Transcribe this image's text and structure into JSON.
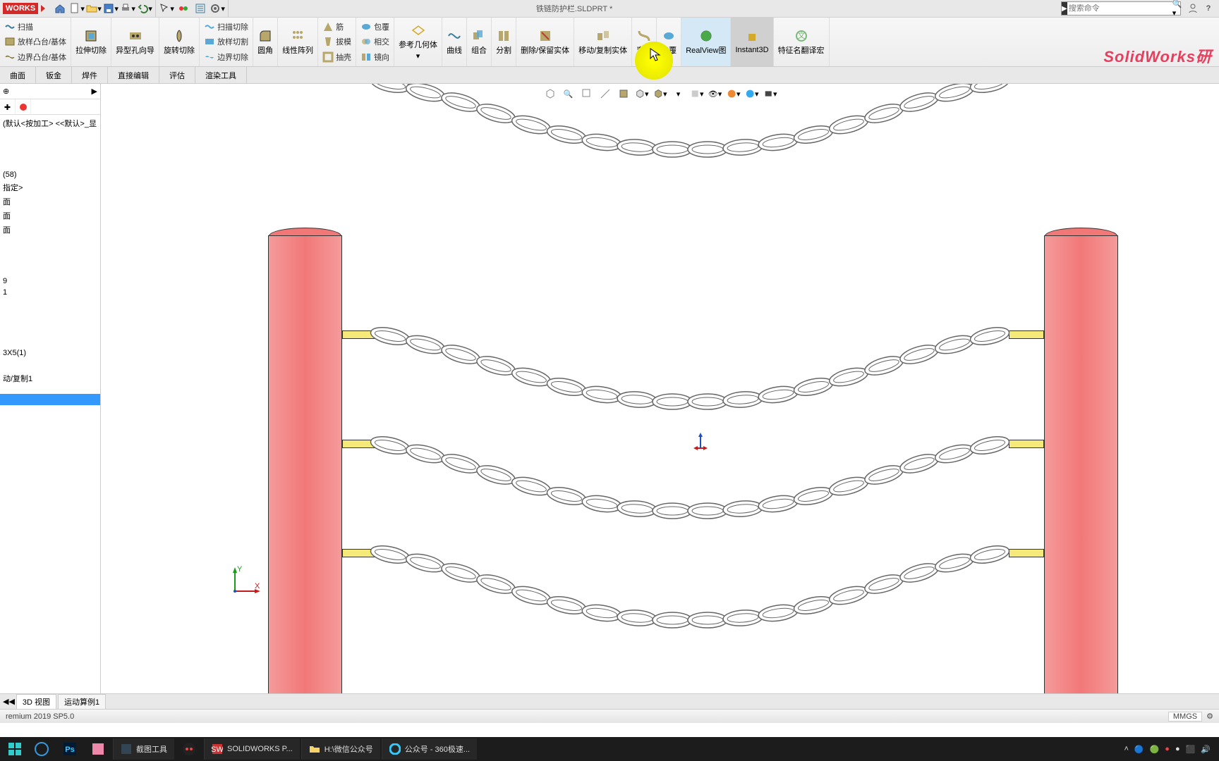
{
  "window_title": "铁链防护栏.SLDPRT *",
  "logo": "WORKS",
  "search_placeholder": "搜索命令",
  "brand_watermark": "SolidWorks研",
  "ribbon_left": {
    "r1c1": "扫描",
    "r1c2": "放样凸台/基体",
    "r1c3": "边界凸台/基体",
    "c2_big": "拉伸切除",
    "c3_big": "异型孔向导",
    "c4_big": "旋转切除",
    "c5r1": "扫描切除",
    "c5r2": "放样切割",
    "c5r3": "边界切除",
    "c6_big": "圆角",
    "c7_big": "线性阵列",
    "c8r1": "筋",
    "c8r2": "拔模",
    "c8r3": "抽壳",
    "c9r1": "包覆",
    "c9r2": "相交",
    "c9r3": "镜向",
    "c10_big": "参考几何体",
    "c11_big": "曲线",
    "c12_big": "组合",
    "c13_big": "分割",
    "c14_big": "删除/保留实体",
    "c15_big": "移动/复制实体",
    "c16_big": "弯曲",
    "c17_big": "包覆",
    "c18_big": "RealView图",
    "c19_big": "Instant3D",
    "c20_big": "特征名翻译宏"
  },
  "tabs": [
    "曲面",
    "钣金",
    "焊件",
    "直接编辑",
    "评估",
    "渲染工具"
  ],
  "tree": {
    "root": "(默认<按加工> <<默认>_显",
    "i1": "(58)",
    "i2": "指定>",
    "i3": "面",
    "i4": "面",
    "i5": "面",
    "i6": "9",
    "i7": "1",
    "i8": "3X5(1)",
    "i9": "动/复制1"
  },
  "bottom_tabs": {
    "b1": "3D 视图",
    "b2": "运动算例1"
  },
  "status_left": "remium 2019 SP5.0",
  "status_unit": "MMGS",
  "taskbar": {
    "t1": "截图工具",
    "t2": "SOLIDWORKS P...",
    "t3": "H:\\微信公众号",
    "t4": "公众号 - 360极速..."
  }
}
